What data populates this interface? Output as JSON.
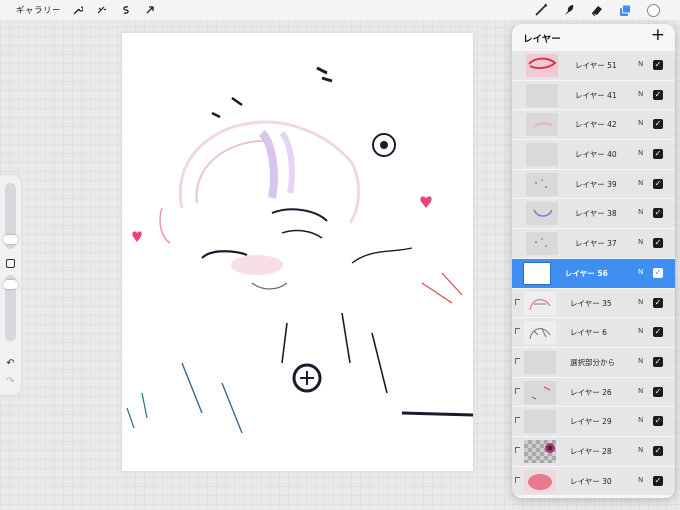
{
  "toolbar": {
    "gallery_label": "ギャラリー",
    "left_tools": [
      {
        "name": "actions-wrench-icon",
        "glyph": "🔧"
      },
      {
        "name": "adjustments-magic-icon",
        "glyph": "ﾉ"
      },
      {
        "name": "selection-s-icon",
        "glyph": "S"
      },
      {
        "name": "transform-arrow-icon",
        "glyph": "↗"
      }
    ],
    "right_tools": [
      "brush-icon",
      "smudge-icon",
      "eraser-icon",
      "layers-icon",
      "color-picker-icon"
    ],
    "accent_color": "#3f8ff2"
  },
  "sidebar": {
    "undo_glyph": "↶",
    "redo_glyph": "↷"
  },
  "layers_panel": {
    "title": "レイヤー",
    "add_glyph": "+",
    "layers": [
      {
        "name": "レイヤー 51",
        "mode": "N",
        "visible": true,
        "selected": false,
        "clipped": false,
        "thumb": "pink-scribble"
      },
      {
        "name": "レイヤー 41",
        "mode": "N",
        "visible": true,
        "selected": false,
        "clipped": false,
        "thumb": "gray"
      },
      {
        "name": "レイヤー 42",
        "mode": "N",
        "visible": true,
        "selected": false,
        "clipped": false,
        "thumb": "pink-faint"
      },
      {
        "name": "レイヤー 40",
        "mode": "N",
        "visible": true,
        "selected": false,
        "clipped": false,
        "thumb": "gray"
      },
      {
        "name": "レイヤー 39",
        "mode": "N",
        "visible": true,
        "selected": false,
        "clipped": false,
        "thumb": "gray-dots"
      },
      {
        "name": "レイヤー 38",
        "mode": "N",
        "visible": true,
        "selected": false,
        "clipped": false,
        "thumb": "purple-arc"
      },
      {
        "name": "レイヤー 37",
        "mode": "N",
        "visible": true,
        "selected": false,
        "clipped": false,
        "thumb": "gray-dots"
      },
      {
        "name": "レイヤー 56",
        "mode": "N",
        "visible": true,
        "selected": true,
        "clipped": false,
        "thumb": "white"
      },
      {
        "name": "レイヤー 35",
        "mode": "N",
        "visible": true,
        "selected": false,
        "clipped": true,
        "thumb": "sketch-pink"
      },
      {
        "name": "レイヤー 6",
        "mode": "N",
        "visible": true,
        "selected": false,
        "clipped": true,
        "thumb": "sketch"
      },
      {
        "name": "選択部分から",
        "mode": "N",
        "visible": true,
        "selected": false,
        "clipped": true,
        "thumb": "gray"
      },
      {
        "name": "レイヤー 26",
        "mode": "N",
        "visible": true,
        "selected": false,
        "clipped": true,
        "thumb": "red-marks"
      },
      {
        "name": "レイヤー 29",
        "mode": "N",
        "visible": true,
        "selected": false,
        "clipped": true,
        "thumb": "gray"
      },
      {
        "name": "レイヤー 28",
        "mode": "N",
        "visible": true,
        "selected": false,
        "clipped": true,
        "thumb": "checker"
      },
      {
        "name": "レイヤー 30",
        "mode": "N",
        "visible": true,
        "selected": false,
        "clipped": true,
        "thumb": "pink-blob"
      }
    ]
  }
}
